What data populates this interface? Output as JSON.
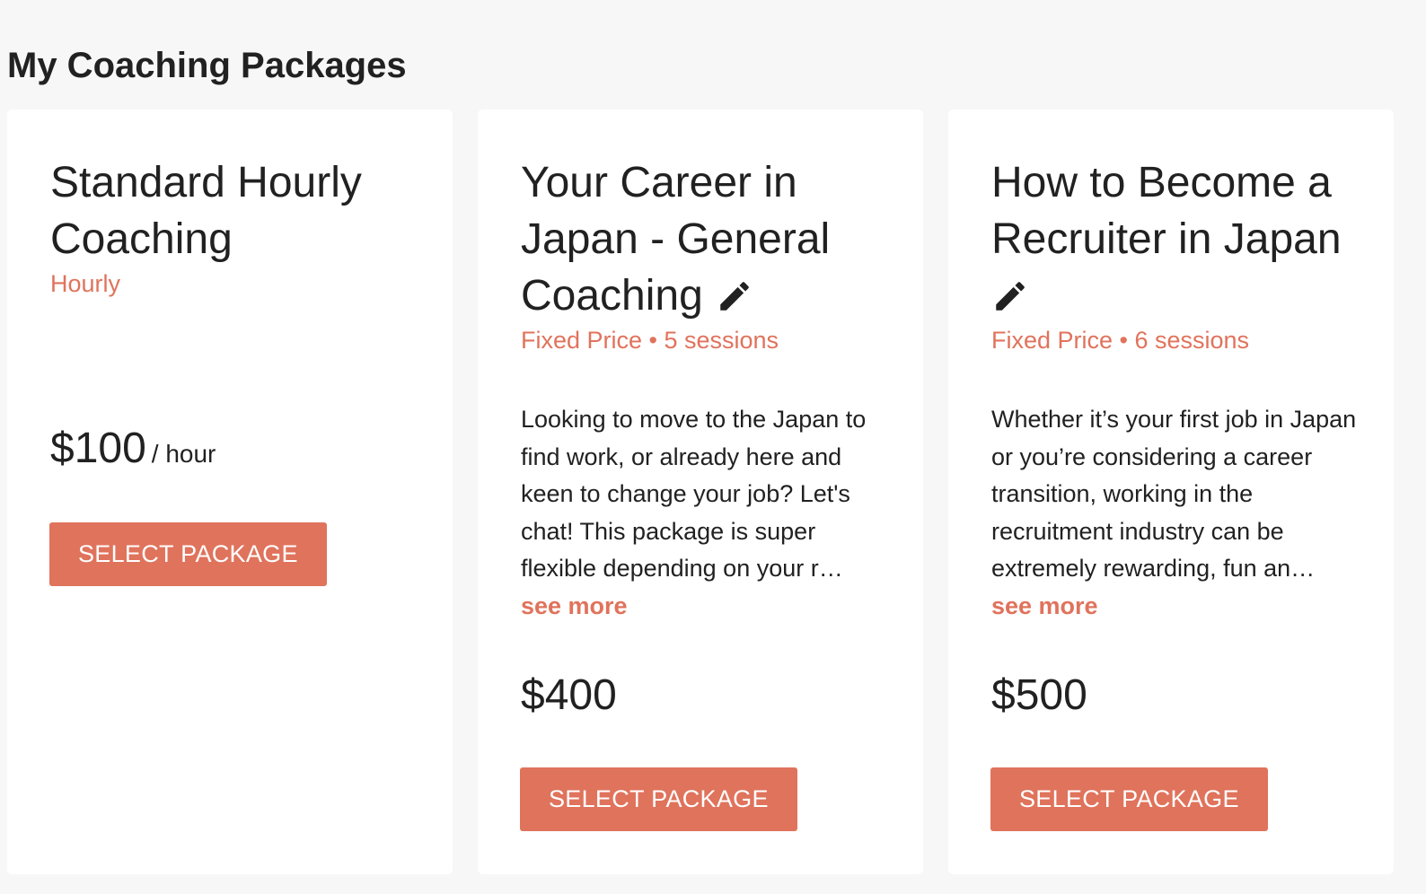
{
  "page": {
    "title": "My Coaching Packages"
  },
  "colors": {
    "accent": "#e0735c",
    "text": "#212121",
    "background": "#f7f7f7",
    "card": "#ffffff"
  },
  "packages": [
    {
      "title": "Standard Hourly Coaching",
      "type": "Hourly",
      "description": "",
      "see_more": "",
      "price": "$100",
      "price_unit": "/ hour",
      "button_label": "SELECT PACKAGE",
      "editable": false
    },
    {
      "title": "Your Career in Japan - General Coaching",
      "type": "Fixed Price • 5 sessions",
      "description": "Looking to move to the Japan to find work, or already here and keen to change your job? Let's chat! This package is super flexible depending on your r…",
      "see_more": "see more",
      "price": "$400",
      "price_unit": "",
      "button_label": "SELECT PACKAGE",
      "editable": true,
      "edit_icon": "pencil-icon"
    },
    {
      "title": "How to Become a Recruiter in Japan",
      "type": "Fixed Price • 6 sessions",
      "description": "Whether it’s your first job in Japan or you’re considering a career transition, working in the recruitment industry can be extremely rewarding, fun an…",
      "see_more": "see more",
      "price": "$500",
      "price_unit": "",
      "button_label": "SELECT PACKAGE",
      "editable": true,
      "edit_icon": "pencil-icon"
    }
  ]
}
